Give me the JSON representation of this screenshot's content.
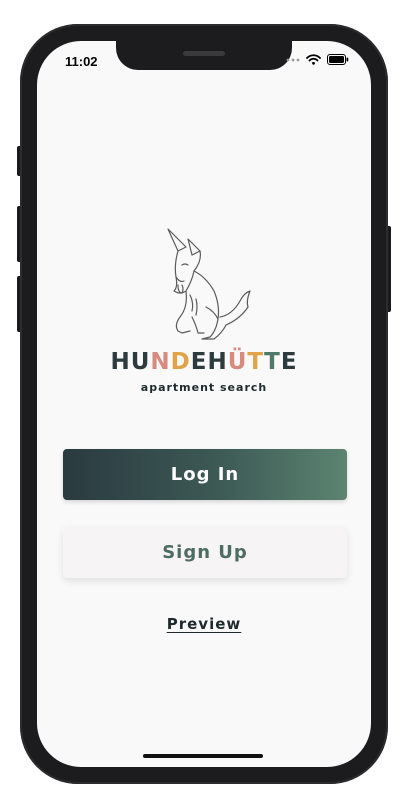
{
  "status_bar": {
    "time": "11:02",
    "icons": [
      "signal-dots-icon",
      "wifi-icon",
      "battery-icon"
    ]
  },
  "logo": {
    "icon": "dog-illustration-icon",
    "brand_letters": [
      {
        "char": "H",
        "color": "#2d3b3e"
      },
      {
        "char": "U",
        "color": "#2d3b3e"
      },
      {
        "char": "N",
        "color": "#d98a7e"
      },
      {
        "char": "D",
        "color": "#e0a34a"
      },
      {
        "char": "E",
        "color": "#2d3b3e"
      },
      {
        "char": "H",
        "color": "#2d3b3e"
      },
      {
        "char": "Ü",
        "color": "#d98a7e"
      },
      {
        "char": "T",
        "color": "#e0a34a"
      },
      {
        "char": "T",
        "color": "#4f7a6a"
      },
      {
        "char": "E",
        "color": "#2d3b3e"
      }
    ],
    "subtitle": "apartment search"
  },
  "actions": {
    "login_label": "Log In",
    "signup_label": "Sign Up",
    "preview_label": "Preview"
  },
  "colors": {
    "login_gradient_start": "#2a3a40",
    "login_gradient_end": "#5c8471",
    "signup_text": "#4d6d63",
    "screen_background": "#f9f9f9"
  }
}
